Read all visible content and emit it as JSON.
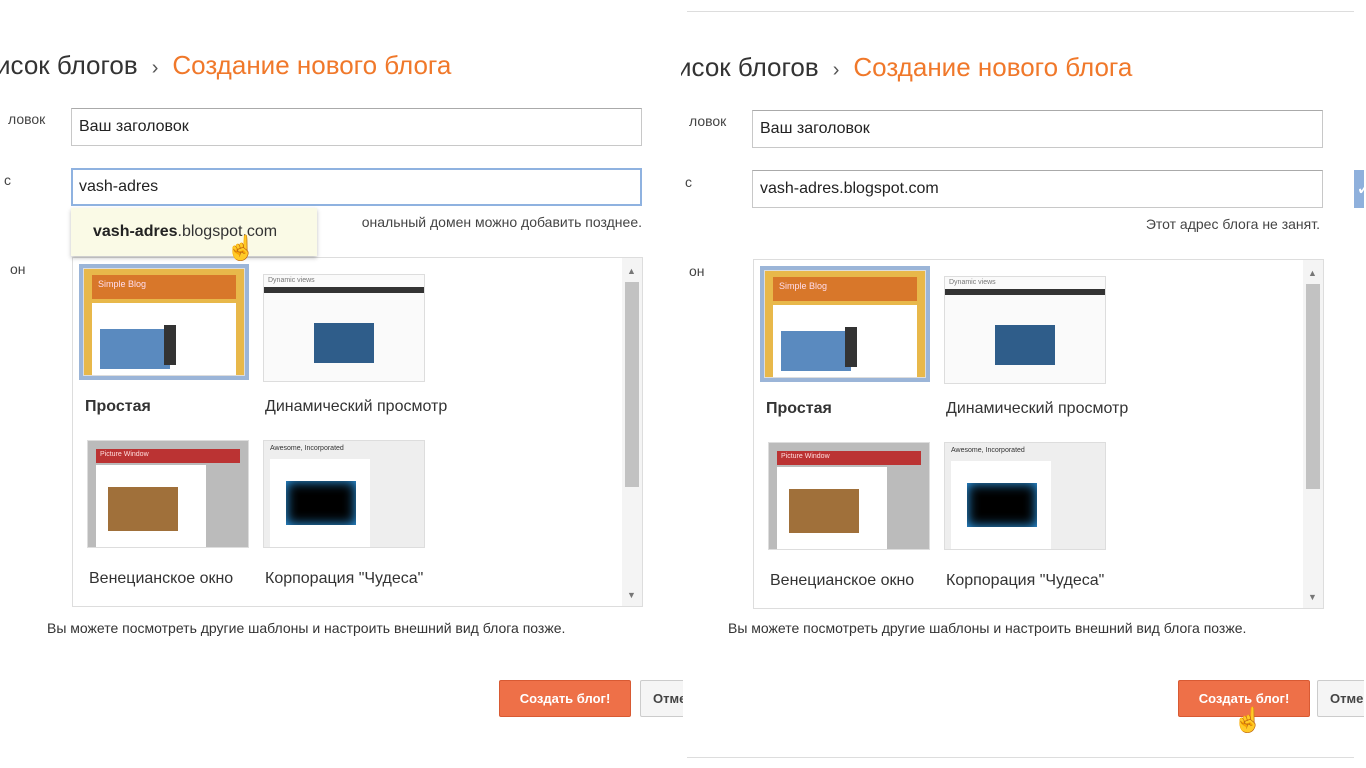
{
  "breadcrumb": {
    "prev": "исок блогов",
    "separator": "›",
    "current": "Создание нового блога"
  },
  "labels": {
    "title": "ловок",
    "address": "с",
    "template": "он"
  },
  "left": {
    "title_value": "Ваш заголовок",
    "address_value": "vash-adres",
    "suggestion_bold": "vash-adres",
    "suggestion_rest": ".blogspot.com",
    "hint": "ональный домен можно добавить позднее."
  },
  "right": {
    "title_value": "Ваш заголовок",
    "address_value": "vash-adres.blogspot.com",
    "hint": "Этот адрес блога не занят.",
    "check_icon": "✓"
  },
  "templates": [
    {
      "name": "Простая",
      "thumb_title": "Simple Blog",
      "selected": true
    },
    {
      "name": "Динамический просмотр",
      "thumb_title": "Dynamic views",
      "selected": false
    },
    {
      "name": "Венецианское окно",
      "thumb_title": "Picture Window",
      "selected": false
    },
    {
      "name": "Корпорация \"Чудеса\"",
      "thumb_title": "Awesome, Incorporated",
      "selected": false
    }
  ],
  "footnote": "Вы можете посмотреть другие шаблоны и настроить внешний вид блога позже.",
  "buttons": {
    "create": "Создать блог!",
    "cancel": "Отмена"
  },
  "colors": {
    "accent": "#f0782a",
    "button": "#ee7048",
    "focus": "#8fb2e0"
  }
}
